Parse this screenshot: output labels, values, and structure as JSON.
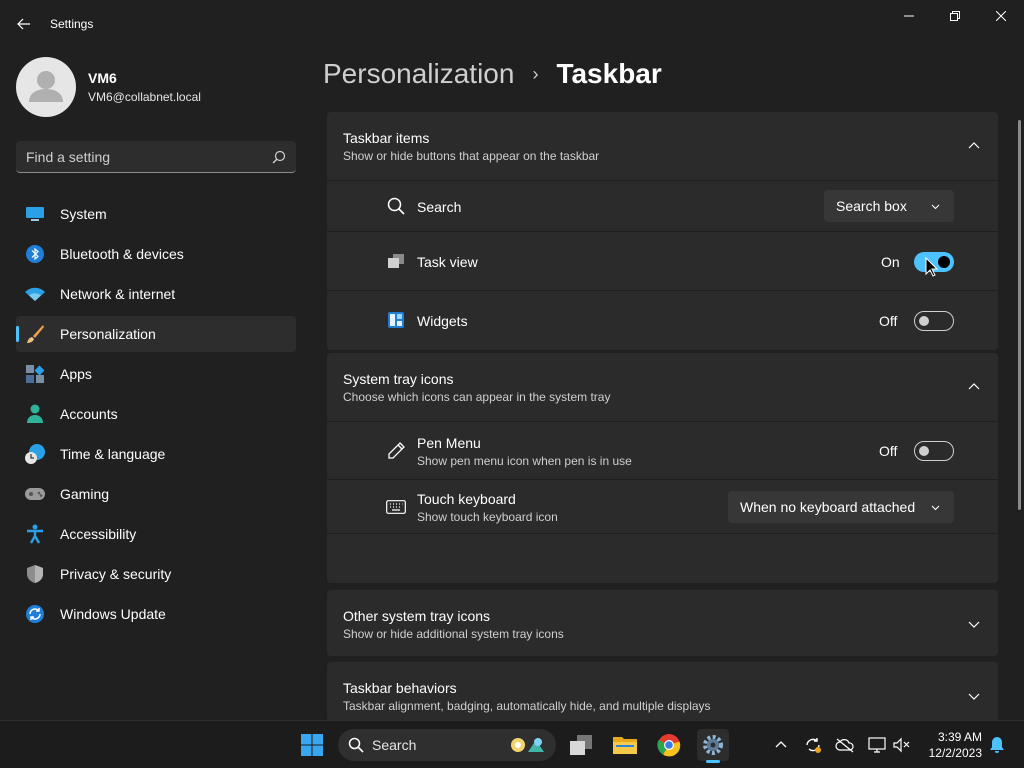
{
  "window": {
    "app_title": "Settings"
  },
  "profile": {
    "name": "VM6",
    "email": "VM6@collabnet.local"
  },
  "search": {
    "placeholder": "Find a setting"
  },
  "sidebar": {
    "items": [
      {
        "label": "System",
        "icon": "system-icon",
        "selected": false
      },
      {
        "label": "Bluetooth & devices",
        "icon": "bluetooth-icon",
        "selected": false
      },
      {
        "label": "Network & internet",
        "icon": "wifi-icon",
        "selected": false
      },
      {
        "label": "Personalization",
        "icon": "brush-icon",
        "selected": true
      },
      {
        "label": "Apps",
        "icon": "apps-icon",
        "selected": false
      },
      {
        "label": "Accounts",
        "icon": "accounts-icon",
        "selected": false
      },
      {
        "label": "Time & language",
        "icon": "clock-globe-icon",
        "selected": false
      },
      {
        "label": "Gaming",
        "icon": "gamepad-icon",
        "selected": false
      },
      {
        "label": "Accessibility",
        "icon": "accessibility-icon",
        "selected": false
      },
      {
        "label": "Privacy & security",
        "icon": "shield-icon",
        "selected": false
      },
      {
        "label": "Windows Update",
        "icon": "update-icon",
        "selected": false
      }
    ]
  },
  "breadcrumb": {
    "parent": "Personalization",
    "separator": "›",
    "current": "Taskbar"
  },
  "taskbar_items": {
    "title": "Taskbar items",
    "subtitle": "Show or hide buttons that appear on the taskbar",
    "search": {
      "label": "Search",
      "value": "Search box"
    },
    "task_view": {
      "label": "Task view",
      "state": "On"
    },
    "widgets": {
      "label": "Widgets",
      "state": "Off"
    }
  },
  "system_tray": {
    "title": "System tray icons",
    "subtitle": "Choose which icons can appear in the system tray",
    "pen_menu": {
      "label": "Pen Menu",
      "description": "Show pen menu icon when pen is in use",
      "state": "Off"
    },
    "touch_keyboard": {
      "label": "Touch keyboard",
      "description": "Show touch keyboard icon",
      "value": "When no keyboard attached"
    }
  },
  "other_tray": {
    "title": "Other system tray icons",
    "subtitle": "Show or hide additional system tray icons"
  },
  "behaviors": {
    "title": "Taskbar behaviors",
    "subtitle": "Taskbar alignment, badging, automatically hide, and multiple displays"
  },
  "taskbar": {
    "search_label": "Search",
    "time": "3:39 AM",
    "date": "12/2/2023"
  },
  "colors": {
    "accent": "#4cc2ff",
    "background": "#202020",
    "card": "#2b2b2b"
  }
}
